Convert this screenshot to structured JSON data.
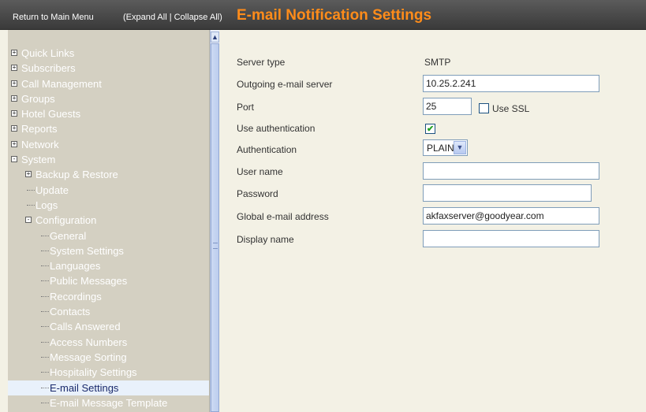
{
  "header": {
    "main_menu_link": "Return to Main Menu",
    "expand_collapse_link": "(Expand All | Collapse All)",
    "title": "E-mail Notification Settings"
  },
  "sidebar": {
    "items": [
      {
        "label": "Quick Links",
        "toggle": "+"
      },
      {
        "label": "Subscribers",
        "toggle": "+"
      },
      {
        "label": "Call Management",
        "toggle": "+"
      },
      {
        "label": "Groups",
        "toggle": "+"
      },
      {
        "label": "Hotel Guests",
        "toggle": "+"
      },
      {
        "label": "Reports",
        "toggle": "+"
      },
      {
        "label": "Network",
        "toggle": "+"
      },
      {
        "label": "System",
        "toggle": "-"
      },
      {
        "label": "Backup & Restore",
        "toggle": "+"
      },
      {
        "label": "Update"
      },
      {
        "label": "Logs"
      },
      {
        "label": "Configuration",
        "toggle": "-"
      },
      {
        "label": "General"
      },
      {
        "label": "System Settings"
      },
      {
        "label": "Languages"
      },
      {
        "label": "Public Messages"
      },
      {
        "label": "Recordings"
      },
      {
        "label": "Contacts"
      },
      {
        "label": "Calls Answered"
      },
      {
        "label": "Access Numbers"
      },
      {
        "label": "Message Sorting"
      },
      {
        "label": "Hospitality Settings"
      },
      {
        "label": "E-mail Settings",
        "selected": true
      },
      {
        "label": "E-mail Message Template"
      }
    ]
  },
  "form": {
    "server_type": {
      "label": "Server type",
      "value": "SMTP"
    },
    "outgoing_server": {
      "label": "Outgoing e-mail server",
      "value": "10.25.2.241"
    },
    "port": {
      "label": "Port",
      "value": "25"
    },
    "use_ssl": {
      "label": "Use SSL",
      "checked": false
    },
    "use_authentication": {
      "label": "Use authentication",
      "checked": true
    },
    "authentication": {
      "label": "Authentication",
      "value": "PLAIN"
    },
    "user_name": {
      "label": "User name",
      "value": ""
    },
    "password": {
      "label": "Password",
      "value": ""
    },
    "global_email": {
      "label": "Global e-mail address",
      "value": "akfaxserver@goodyear.com"
    },
    "display_name": {
      "label": "Display name",
      "value": ""
    }
  },
  "colors": {
    "title": "#ff8c1a",
    "header_bg": "#4a4a4a",
    "sidebar_bg": "#d4d0c2",
    "content_bg": "#f3f1e5",
    "selected_item_bg": "#e9f1fb"
  }
}
